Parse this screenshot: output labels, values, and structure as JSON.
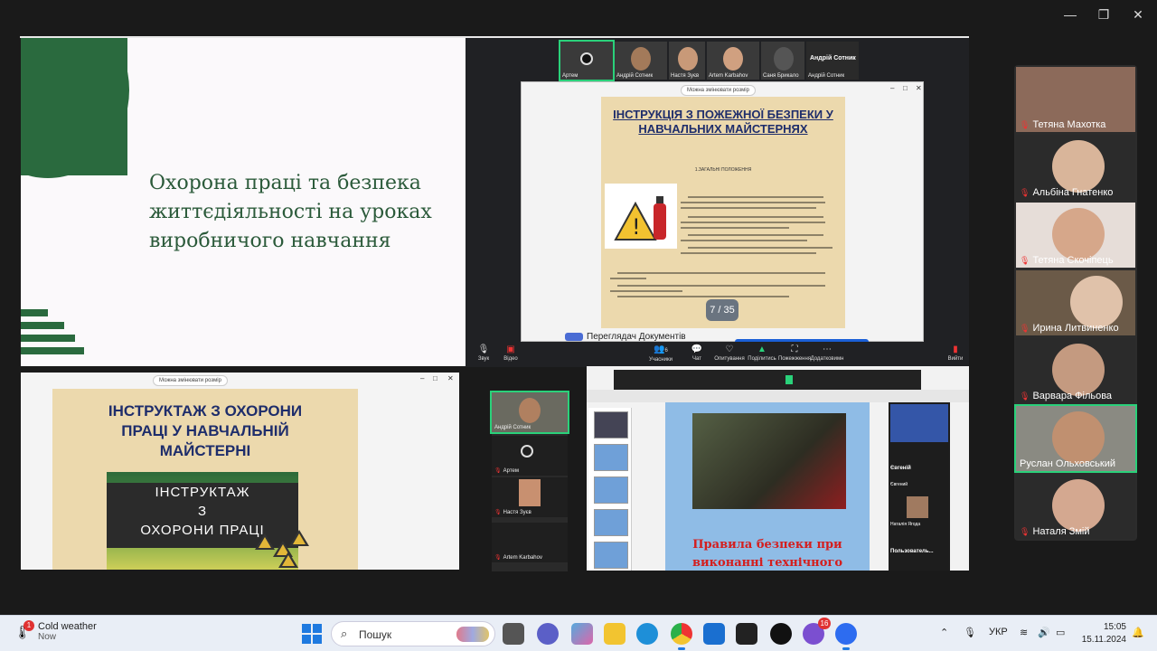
{
  "window": {
    "controls": {
      "minimize": "—",
      "maximize": "❐",
      "close": "✕"
    }
  },
  "slide1": {
    "title": "Охорона праці та безпека\nжиттєдіяльності на уроках\nвиробничого навчання"
  },
  "top_strip": {
    "participants": [
      {
        "name": "Артем",
        "active": true
      },
      {
        "name": "Андрій Сотник"
      },
      {
        "name": "Настя Зуєв"
      },
      {
        "name": "Artem Karbahov"
      },
      {
        "name": "Саня Брикало"
      }
    ],
    "name_tile": {
      "big": "Андрій Сотник",
      "small": "Андрій Сотник"
    }
  },
  "doc_viewer": {
    "resize_label": "Можна змінювати розмір",
    "title": "ІНСТРУКЦІЯ З ПОЖЕЖНОЇ БЕЗПЕКИ У\nНАВЧАЛЬНИХ МАЙСТЕРНЯХ",
    "section": "1.ЗАГАЛЬНІ ПОЛОЖЕННЯ",
    "page_counter": "7 / 35",
    "footer": "Переглядач Документів"
  },
  "toolbar1": {
    "items": [
      "Звук",
      "Відео",
      "Учасники",
      "Чат",
      "Опитування",
      "Поділитись",
      "Пожежження",
      "Додатковимн",
      "Вийти"
    ],
    "participants_count": "6"
  },
  "slide2": {
    "resize_label": "Можна змінювати розмір",
    "title": "ІНСТРУКТАЖ З ОХОРОНИ\nПРАЦІ У НАВЧАЛЬНІЙ\nМАЙСТЕРНІ",
    "banner": "ІНСТРУКТАЖ\nЗ\nОХОРОНИ ПРАЦІ"
  },
  "participant_column": {
    "tiles": [
      {
        "name": "Андрій Сотник",
        "active": true
      },
      {
        "name": "Артем"
      },
      {
        "name": "Настя Зуєв"
      },
      {
        "name": "Artem Karbahov"
      }
    ]
  },
  "share3": {
    "slide_title": "Правила безпеки при\nвиконанні технічного",
    "right_column": [
      "Євгеній",
      "Євгений",
      "Наталія Ягода",
      "Пользователь..."
    ]
  },
  "gallery": {
    "participants": [
      {
        "name": "Тетяна Махотка",
        "muted": true
      },
      {
        "name": "Альбіна Гнатенко",
        "muted": true
      },
      {
        "name": "Тетяна Скочіпець",
        "muted": true
      },
      {
        "name": "Ирина Литвиненко",
        "muted": true
      },
      {
        "name": "Варвара Фільова",
        "muted": true
      },
      {
        "name": "Руслан Ольховський",
        "muted": false,
        "active": true
      },
      {
        "name": "Наталя Змій",
        "muted": true
      }
    ]
  },
  "taskbar": {
    "weather": {
      "title": "Cold weather",
      "subtitle": "Now",
      "badge": "1"
    },
    "search_placeholder": "Пошук",
    "viber_badge": "16",
    "language": "УКР",
    "time": "15:05",
    "date": "15.11.2024"
  },
  "colors": {
    "slide_green": "#2a6a3e",
    "doc_title_blue": "#1e2d6b",
    "active_green": "#2ad17a",
    "mute_red": "#e33333"
  }
}
